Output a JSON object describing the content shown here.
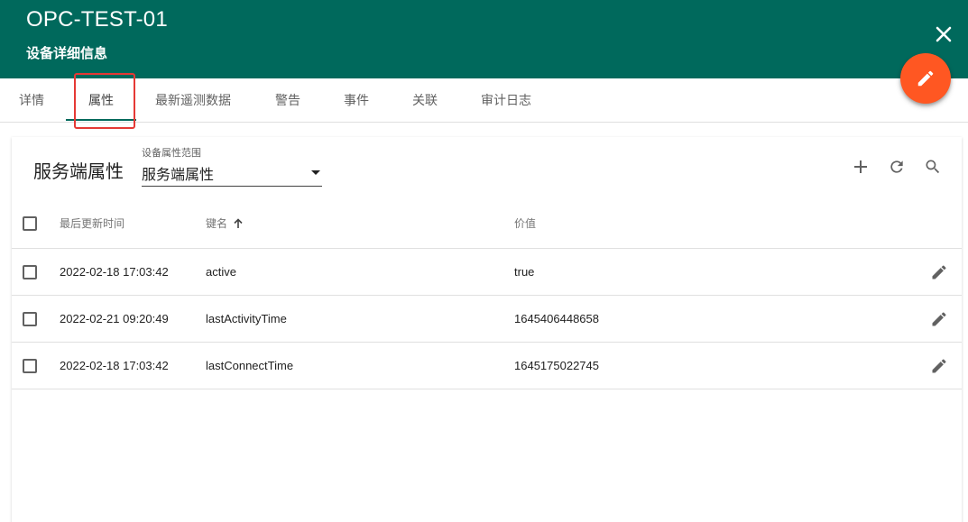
{
  "header": {
    "title": "OPC-TEST-01",
    "subtitle": "设备详细信息",
    "close_icon": "close-icon",
    "fab_icon": "pencil-icon",
    "fab_color": "#ff5722",
    "bg_color": "#00695c"
  },
  "tabs": [
    {
      "label": "详情"
    },
    {
      "label": "属性",
      "active": true
    },
    {
      "label": "最新遥测数据"
    },
    {
      "label": "警告"
    },
    {
      "label": "事件"
    },
    {
      "label": "关联"
    },
    {
      "label": "审计日志"
    }
  ],
  "card": {
    "title": "服务端属性",
    "scope_label": "设备属性范围",
    "scope_value": "服务端属性",
    "toolbar_icons": [
      "add-icon",
      "refresh-icon",
      "search-icon"
    ]
  },
  "table": {
    "columns": {
      "time": "最后更新时间",
      "key": "键名",
      "value": "价值"
    },
    "sort_icon": "arrow-up-icon",
    "rows": [
      {
        "time": "2022-02-18 17:03:42",
        "key": "active",
        "value": "true"
      },
      {
        "time": "2022-02-21 09:20:49",
        "key": "lastActivityTime",
        "value": "1645406448658"
      },
      {
        "time": "2022-02-18 17:03:42",
        "key": "lastConnectTime",
        "value": "1645175022745"
      }
    ]
  }
}
